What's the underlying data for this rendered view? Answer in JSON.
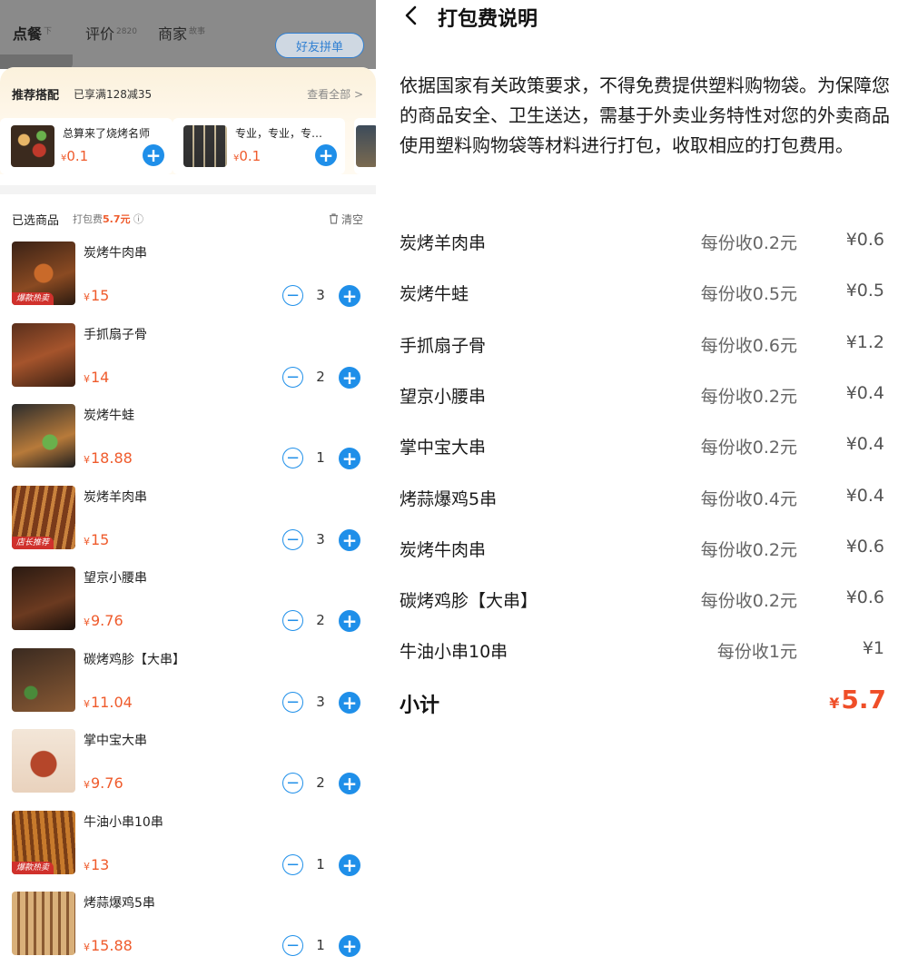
{
  "left": {
    "tabs": [
      {
        "label": "点餐",
        "sup": "下"
      },
      {
        "label": "评价",
        "sup": "2820"
      },
      {
        "label": "商家",
        "sup": "故事"
      }
    ],
    "friend_button": "好友拼单",
    "recommend": {
      "title": "推荐搭配",
      "promo": "已享满128减35",
      "view_all": "查看全部 >",
      "cards": [
        {
          "name": "总算来了烧烤名师",
          "currency": "¥",
          "price": "0.1"
        },
        {
          "name": "专业，专业，专…",
          "currency": "¥",
          "price": "0.1"
        }
      ]
    },
    "selected": {
      "title": "已选商品",
      "fee_label": "打包费",
      "fee_value": "5.7元",
      "help": "ⓘ",
      "clear": "清空",
      "items": [
        {
          "name": "炭烤牛肉串",
          "currency": "¥",
          "price": "15",
          "qty": "3",
          "tag": "爆款热卖"
        },
        {
          "name": "手抓扇子骨",
          "currency": "¥",
          "price": "14",
          "qty": "2",
          "tag": ""
        },
        {
          "name": "炭烤牛蛙",
          "currency": "¥",
          "price": "18.88",
          "qty": "1",
          "tag": ""
        },
        {
          "name": "炭烤羊肉串",
          "currency": "¥",
          "price": "15",
          "qty": "3",
          "tag": "店长推荐"
        },
        {
          "name": "望京小腰串",
          "currency": "¥",
          "price": "9.76",
          "qty": "2",
          "tag": ""
        },
        {
          "name": "碳烤鸡胗【大串】",
          "currency": "¥",
          "price": "11.04",
          "qty": "3",
          "tag": ""
        },
        {
          "name": "掌中宝大串",
          "currency": "¥",
          "price": "9.76",
          "qty": "2",
          "tag": ""
        },
        {
          "name": "牛油小串10串",
          "currency": "¥",
          "price": "13",
          "qty": "1",
          "tag": "爆款热卖"
        },
        {
          "name": "烤蒜爆鸡5串",
          "currency": "¥",
          "price": "15.88",
          "qty": "1",
          "tag": ""
        }
      ]
    }
  },
  "right": {
    "title": "打包费说明",
    "description": "依据国家有关政策要求，不得免费提供塑料购物袋。为保障您的商品安全、卫生送达，需基于外卖业务特性对您的外卖商品使用塑料购物袋等材料进行打包，收取相应的打包费用。",
    "rows": [
      {
        "name": "炭烤羊肉串",
        "rate": "每份收0.2元",
        "amount": "¥0.6"
      },
      {
        "name": "炭烤牛蛙",
        "rate": "每份收0.5元",
        "amount": "¥0.5"
      },
      {
        "name": "手抓扇子骨",
        "rate": "每份收0.6元",
        "amount": "¥1.2"
      },
      {
        "name": "望京小腰串",
        "rate": "每份收0.2元",
        "amount": "¥0.4"
      },
      {
        "name": "掌中宝大串",
        "rate": "每份收0.2元",
        "amount": "¥0.4"
      },
      {
        "name": "烤蒜爆鸡5串",
        "rate": "每份收0.4元",
        "amount": "¥0.4"
      },
      {
        "name": "炭烤牛肉串",
        "rate": "每份收0.2元",
        "amount": "¥0.6"
      },
      {
        "name": "碳烤鸡胗【大串】",
        "rate": "每份收0.2元",
        "amount": "¥0.6"
      },
      {
        "name": "牛油小串10串",
        "rate": "每份收1元",
        "amount": "¥1"
      }
    ],
    "subtotal_label": "小计",
    "subtotal_currency": "¥",
    "subtotal_value": "5.7"
  },
  "colors": {
    "accent": "#1f8fe9",
    "price": "#ef5b2c",
    "subtotal": "#ef4e28"
  },
  "icons": [
    "back-chevron-icon",
    "plus-icon",
    "minus-icon",
    "trash-icon",
    "help-icon"
  ]
}
